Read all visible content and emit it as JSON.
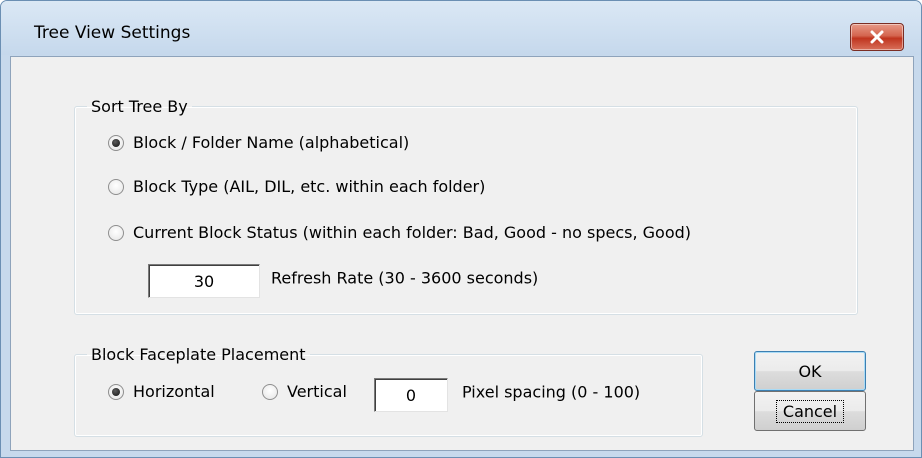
{
  "window": {
    "title": "Tree View Settings"
  },
  "sort_group": {
    "legend": "Sort Tree By",
    "options": [
      {
        "label": "Block / Folder Name (alphabetical)",
        "checked": true
      },
      {
        "label": "Block Type (AIL, DIL, etc. within each folder)",
        "checked": false
      },
      {
        "label": "Current Block Status (within each folder: Bad, Good - no specs, Good)",
        "checked": false
      }
    ],
    "refresh_value": "30",
    "refresh_label": "Refresh Rate (30 - 3600 seconds)"
  },
  "faceplate_group": {
    "legend": "Block Faceplate Placement",
    "horizontal_label": "Horizontal",
    "horizontal_checked": true,
    "vertical_label": "Vertical",
    "vertical_checked": false,
    "spacing_value": "0",
    "spacing_label": "Pixel spacing (0 - 100)"
  },
  "buttons": {
    "ok": "OK",
    "cancel": "Cancel"
  },
  "colors": {
    "frame": "#c7d9ec",
    "client": "#f0f0f0",
    "close": "#c7432c"
  },
  "icons": {
    "close": "close-icon"
  }
}
